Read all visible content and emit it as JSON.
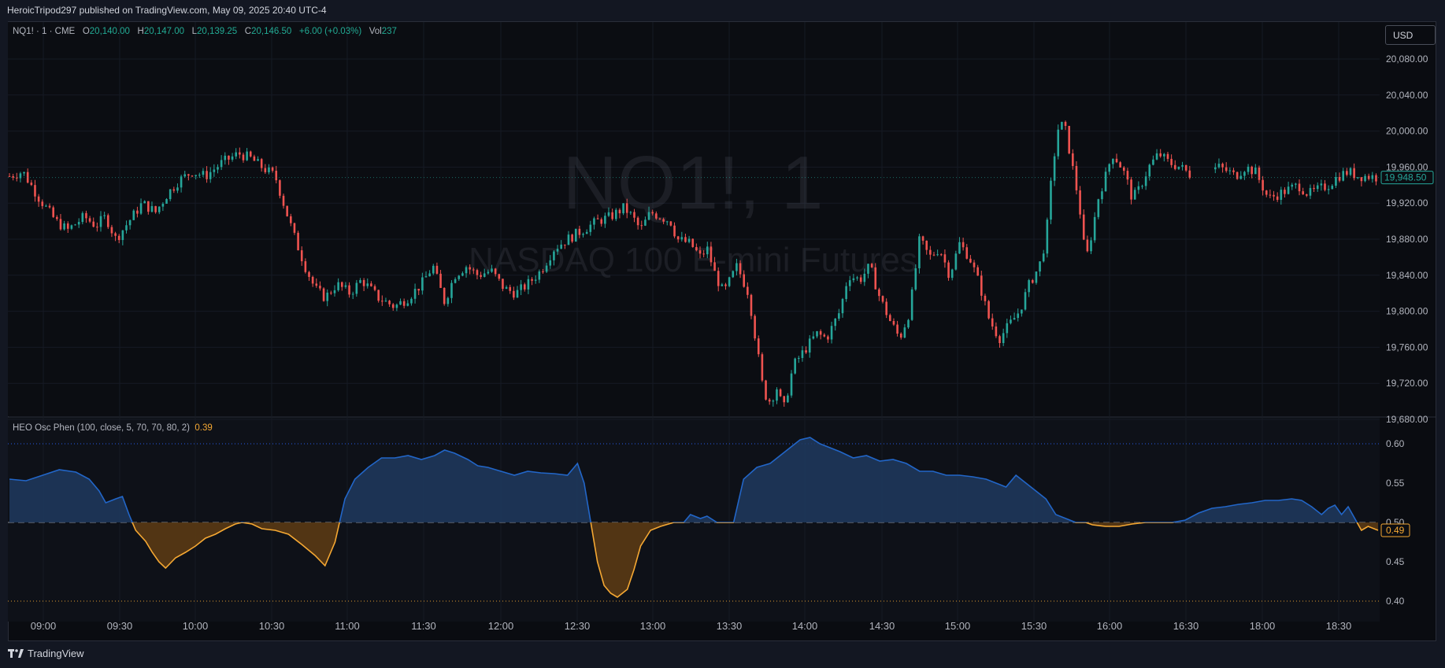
{
  "header": {
    "published": "HeroicTripod297 published on TradingView.com, May 09, 2025 20:40 UTC-4"
  },
  "symbol": {
    "name": "NQ1! · 1 · CME",
    "o_label": "O",
    "o": "20,140.00",
    "h_label": "H",
    "h": "20,147.00",
    "l_label": "L",
    "l": "20,139.25",
    "c_label": "C",
    "c": "20,146.50",
    "change": "+6.00 (+0.03%)",
    "vol_label": "Vol",
    "vol": "237"
  },
  "currency_button": "USD",
  "watermark": {
    "line1": "NQ1!, 1",
    "line2": "NASDAQ 100 E-mini Futures"
  },
  "indicator": {
    "name": "HEO Osc Phen (100, close, 5, 70, 70, 80, 2)",
    "value": "0.39"
  },
  "footer": {
    "brand": "TradingView"
  },
  "colors": {
    "up": "#26a69a",
    "down": "#ef5350",
    "osc_line": "#2962ff",
    "osc_fill_up": "#1e3a5f",
    "osc_down": "#f5a833",
    "osc_fill_down": "#5a3a14"
  },
  "chart_data": [
    {
      "type": "candlestick",
      "title": "NQ1!, 1",
      "x_ticks": [
        "09:00",
        "09:30",
        "10:00",
        "10:30",
        "11:00",
        "11:30",
        "12:00",
        "12:30",
        "13:00",
        "13:30",
        "14:00",
        "14:30",
        "15:00",
        "15:30",
        "16:00",
        "16:30",
        "18:00",
        "18:30"
      ],
      "y_ticks": [
        "20,080.00",
        "20,040.00",
        "20,000.00",
        "19,960.00",
        "19,920.00",
        "19,880.00",
        "19,840.00",
        "19,800.00",
        "19,760.00",
        "19,720.00",
        "19,680.00"
      ],
      "ylim": [
        19665,
        20100
      ],
      "last_price_label": "19,948.50",
      "last_price": 19948.5,
      "close_path": [
        [
          0,
          19950
        ],
        [
          8,
          19955
        ],
        [
          18,
          19925
        ],
        [
          28,
          19900
        ],
        [
          35,
          19890
        ],
        [
          45,
          19905
        ],
        [
          52,
          19895
        ],
        [
          58,
          19905
        ],
        [
          64,
          19880
        ],
        [
          70,
          19895
        ],
        [
          80,
          19920
        ],
        [
          88,
          19910
        ],
        [
          95,
          19930
        ],
        [
          102,
          19945
        ],
        [
          110,
          19955
        ],
        [
          118,
          19950
        ],
        [
          128,
          19965
        ],
        [
          138,
          19975
        ],
        [
          145,
          19970
        ],
        [
          152,
          19960
        ],
        [
          160,
          19950
        ],
        [
          165,
          19920
        ],
        [
          172,
          19880
        ],
        [
          178,
          19850
        ],
        [
          184,
          19825
        ],
        [
          190,
          19815
        ],
        [
          197,
          19830
        ],
        [
          205,
          19820
        ],
        [
          212,
          19835
        ],
        [
          222,
          19815
        ],
        [
          232,
          19805
        ],
        [
          240,
          19815
        ],
        [
          248,
          19830
        ],
        [
          255,
          19850
        ],
        [
          262,
          19810
        ],
        [
          268,
          19840
        ],
        [
          275,
          19850
        ],
        [
          282,
          19840
        ],
        [
          290,
          19845
        ],
        [
          298,
          19825
        ],
        [
          305,
          19820
        ],
        [
          312,
          19830
        ],
        [
          320,
          19845
        ],
        [
          328,
          19870
        ],
        [
          336,
          19880
        ],
        [
          345,
          19890
        ],
        [
          354,
          19900
        ],
        [
          362,
          19905
        ],
        [
          370,
          19915
        ],
        [
          375,
          19905
        ],
        [
          380,
          19890
        ],
        [
          386,
          19910
        ],
        [
          392,
          19905
        ],
        [
          398,
          19900
        ],
        [
          402,
          19880
        ],
        [
          410,
          19875
        ],
        [
          416,
          19860
        ],
        [
          420,
          19870
        ],
        [
          425,
          19840
        ],
        [
          430,
          19820
        ],
        [
          438,
          19850
        ],
        [
          445,
          19820
        ],
        [
          450,
          19760
        ],
        [
          454,
          19710
        ],
        [
          458,
          19700
        ],
        [
          462,
          19715
        ],
        [
          466,
          19690
        ],
        [
          472,
          19740
        ],
        [
          480,
          19760
        ],
        [
          486,
          19775
        ],
        [
          492,
          19770
        ],
        [
          500,
          19800
        ],
        [
          505,
          19840
        ],
        [
          512,
          19835
        ],
        [
          518,
          19850
        ],
        [
          524,
          19815
        ],
        [
          530,
          19790
        ],
        [
          536,
          19770
        ],
        [
          542,
          19800
        ],
        [
          548,
          19880
        ],
        [
          554,
          19860
        ],
        [
          560,
          19870
        ],
        [
          566,
          19840
        ],
        [
          572,
          19875
        ],
        [
          578,
          19860
        ],
        [
          584,
          19830
        ],
        [
          590,
          19790
        ],
        [
          596,
          19770
        ],
        [
          602,
          19785
        ],
        [
          608,
          19800
        ],
        [
          614,
          19830
        ],
        [
          620,
          19850
        ],
        [
          624,
          19880
        ],
        [
          628,
          19960
        ],
        [
          632,
          20010
        ],
        [
          636,
          20000
        ],
        [
          640,
          19960
        ],
        [
          644,
          19920
        ],
        [
          648,
          19855
        ],
        [
          652,
          19890
        ],
        [
          656,
          19930
        ],
        [
          660,
          19950
        ],
        [
          664,
          19975
        ],
        [
          668,
          19965
        ],
        [
          672,
          19950
        ],
        [
          676,
          19925
        ],
        [
          680,
          19935
        ],
        [
          686,
          19960
        ],
        [
          692,
          19975
        ],
        [
          698,
          19965
        ],
        [
          705,
          19960
        ],
        [
          712,
          19950
        ],
        [
          720,
          19955
        ],
        [
          728,
          19960
        ],
        [
          734,
          19955
        ],
        [
          738,
          19950
        ],
        [
          744,
          19960
        ],
        [
          750,
          19955
        ],
        [
          754,
          19940
        ],
        [
          758,
          19925
        ],
        [
          764,
          19930
        ],
        [
          770,
          19935
        ],
        [
          776,
          19940
        ],
        [
          782,
          19930
        ],
        [
          788,
          19935
        ],
        [
          794,
          19940
        ],
        [
          800,
          19950
        ],
        [
          806,
          19955
        ],
        [
          812,
          19950
        ],
        [
          818,
          19950
        ],
        [
          824,
          19948.5
        ]
      ]
    },
    {
      "type": "line",
      "title": "HEO Osc Phen (100, close, 5, 70, 70, 80, 2)",
      "y_ticks": [
        "0.60",
        "0.55",
        "0.50",
        "0.45",
        "0.40"
      ],
      "ylim": [
        0.38,
        0.625
      ],
      "levels": [
        0.6,
        0.5,
        0.4
      ],
      "last_value": 0.49,
      "last_value_label": "0.49",
      "series": [
        [
          0,
          0.555
        ],
        [
          10,
          0.553
        ],
        [
          20,
          0.56
        ],
        [
          30,
          0.567
        ],
        [
          40,
          0.564
        ],
        [
          48,
          0.555
        ],
        [
          54,
          0.54
        ],
        [
          58,
          0.525
        ],
        [
          64,
          0.53
        ],
        [
          68,
          0.533
        ],
        [
          72,
          0.51
        ],
        [
          76,
          0.49
        ],
        [
          82,
          0.476
        ],
        [
          86,
          0.462
        ],
        [
          90,
          0.45
        ],
        [
          94,
          0.442
        ],
        [
          100,
          0.455
        ],
        [
          106,
          0.462
        ],
        [
          112,
          0.47
        ],
        [
          118,
          0.48
        ],
        [
          124,
          0.485
        ],
        [
          130,
          0.492
        ],
        [
          136,
          0.498
        ],
        [
          140,
          0.5
        ],
        [
          146,
          0.498
        ],
        [
          152,
          0.492
        ],
        [
          160,
          0.49
        ],
        [
          168,
          0.485
        ],
        [
          176,
          0.472
        ],
        [
          184,
          0.458
        ],
        [
          190,
          0.445
        ],
        [
          196,
          0.475
        ],
        [
          202,
          0.53
        ],
        [
          208,
          0.555
        ],
        [
          216,
          0.57
        ],
        [
          224,
          0.582
        ],
        [
          232,
          0.582
        ],
        [
          240,
          0.585
        ],
        [
          248,
          0.58
        ],
        [
          256,
          0.585
        ],
        [
          262,
          0.592
        ],
        [
          268,
          0.588
        ],
        [
          276,
          0.58
        ],
        [
          282,
          0.572
        ],
        [
          288,
          0.57
        ],
        [
          296,
          0.565
        ],
        [
          304,
          0.56
        ],
        [
          312,
          0.565
        ],
        [
          320,
          0.563
        ],
        [
          328,
          0.562
        ],
        [
          336,
          0.56
        ],
        [
          342,
          0.575
        ],
        [
          346,
          0.55
        ],
        [
          350,
          0.5
        ],
        [
          354,
          0.45
        ],
        [
          358,
          0.42
        ],
        [
          362,
          0.41
        ],
        [
          366,
          0.405
        ],
        [
          372,
          0.415
        ],
        [
          376,
          0.44
        ],
        [
          380,
          0.47
        ],
        [
          386,
          0.49
        ],
        [
          392,
          0.495
        ],
        [
          400,
          0.5
        ],
        [
          406,
          0.5
        ],
        [
          410,
          0.51
        ],
        [
          416,
          0.505
        ],
        [
          420,
          0.508
        ],
        [
          426,
          0.5
        ],
        [
          432,
          0.5
        ],
        [
          436,
          0.5
        ],
        [
          442,
          0.555
        ],
        [
          450,
          0.57
        ],
        [
          458,
          0.575
        ],
        [
          464,
          0.585
        ],
        [
          470,
          0.595
        ],
        [
          476,
          0.605
        ],
        [
          482,
          0.608
        ],
        [
          488,
          0.6
        ],
        [
          494,
          0.595
        ],
        [
          500,
          0.59
        ],
        [
          508,
          0.582
        ],
        [
          516,
          0.585
        ],
        [
          524,
          0.578
        ],
        [
          532,
          0.58
        ],
        [
          540,
          0.575
        ],
        [
          548,
          0.565
        ],
        [
          556,
          0.565
        ],
        [
          564,
          0.56
        ],
        [
          572,
          0.56
        ],
        [
          580,
          0.558
        ],
        [
          588,
          0.555
        ],
        [
          594,
          0.55
        ],
        [
          600,
          0.545
        ],
        [
          606,
          0.56
        ],
        [
          612,
          0.55
        ],
        [
          618,
          0.54
        ],
        [
          624,
          0.53
        ],
        [
          630,
          0.51
        ],
        [
          636,
          0.505
        ],
        [
          642,
          0.5
        ],
        [
          648,
          0.5
        ],
        [
          652,
          0.497
        ],
        [
          660,
          0.495
        ],
        [
          668,
          0.495
        ],
        [
          676,
          0.498
        ],
        [
          684,
          0.5
        ],
        [
          692,
          0.5
        ],
        [
          700,
          0.5
        ],
        [
          708,
          0.503
        ],
        [
          716,
          0.512
        ],
        [
          724,
          0.518
        ],
        [
          732,
          0.52
        ],
        [
          740,
          0.523
        ],
        [
          748,
          0.525
        ],
        [
          756,
          0.528
        ],
        [
          764,
          0.528
        ],
        [
          772,
          0.53
        ],
        [
          778,
          0.528
        ],
        [
          784,
          0.52
        ],
        [
          790,
          0.51
        ],
        [
          794,
          0.518
        ],
        [
          798,
          0.522
        ],
        [
          802,
          0.51
        ],
        [
          806,
          0.52
        ],
        [
          810,
          0.505
        ],
        [
          814,
          0.49
        ],
        [
          818,
          0.495
        ],
        [
          824,
          0.49
        ]
      ]
    }
  ]
}
